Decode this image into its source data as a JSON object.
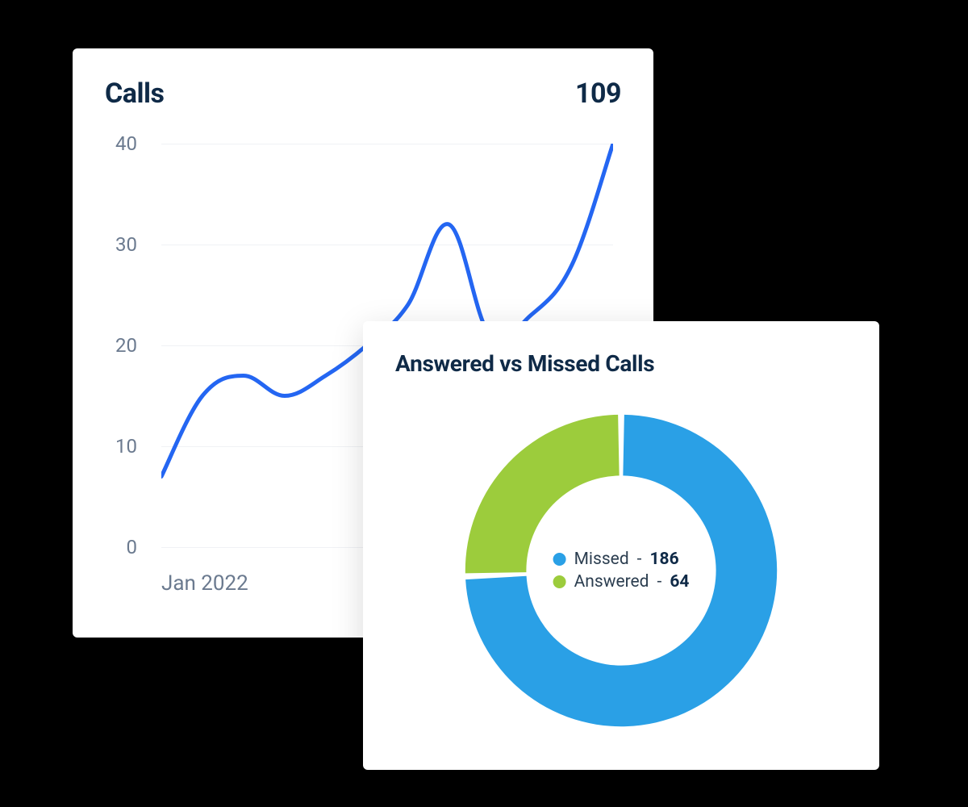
{
  "calls_card": {
    "title": "Calls",
    "total": "109",
    "y_ticks": [
      "40",
      "30",
      "20",
      "10",
      "0"
    ],
    "x_label": "Jan 2022"
  },
  "donut_card": {
    "title": "Answered vs Missed Calls",
    "legend": [
      {
        "label": "Missed",
        "value": "186",
        "color": "#2aa0e6"
      },
      {
        "label": "Answered",
        "value": "64",
        "color": "#9ccc3c"
      }
    ]
  },
  "colors": {
    "line": "#2466f2",
    "blue": "#2aa0e6",
    "green": "#9ccc3c"
  },
  "chart_data": [
    {
      "type": "line",
      "title": "Calls",
      "xlabel": "Jan 2022",
      "ylabel": "",
      "ylim": [
        0,
        40
      ],
      "x": [
        0,
        1,
        2,
        3,
        4,
        5,
        6,
        7,
        8,
        9,
        10,
        11
      ],
      "values": [
        7,
        15,
        17,
        15,
        17,
        20,
        24,
        32,
        21,
        23,
        28,
        40
      ],
      "total": 109
    },
    {
      "type": "pie",
      "title": "Answered vs Missed Calls",
      "series": [
        {
          "name": "Missed",
          "value": 186,
          "color": "#2aa0e6"
        },
        {
          "name": "Answered",
          "value": 64,
          "color": "#9ccc3c"
        }
      ]
    }
  ]
}
